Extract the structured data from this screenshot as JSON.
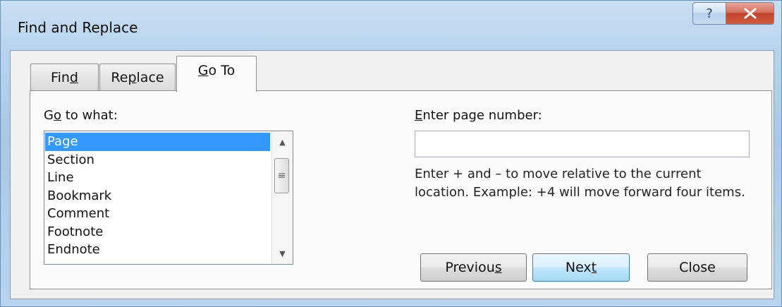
{
  "window": {
    "title": "Find and Replace",
    "help_glyph": "?",
    "close_glyph": "X"
  },
  "tabs": [
    {
      "pre": "Fin",
      "key": "d",
      "post": ""
    },
    {
      "pre": "Re",
      "key": "p",
      "post": "lace"
    },
    {
      "pre": "",
      "key": "G",
      "post": "o To"
    }
  ],
  "goto": {
    "label_pre": "G",
    "label_key": "o",
    "label_post": " to what:",
    "items": [
      "Page",
      "Section",
      "Line",
      "Bookmark",
      "Comment",
      "Footnote",
      "Endnote"
    ],
    "selected": "Page",
    "page_label_key": "E",
    "page_label_post": "nter page number:",
    "page_value": "",
    "hint": "Enter + and – to move relative to the current location. Example: +4 will move forward four items."
  },
  "buttons": {
    "previous_pre": "Previou",
    "previous_key": "s",
    "previous_post": "",
    "next_pre": "Nex",
    "next_key": "t",
    "next_post": "",
    "close": "Close"
  },
  "scroll": {
    "up": "▲",
    "down": "▼",
    "grip": "≡"
  }
}
